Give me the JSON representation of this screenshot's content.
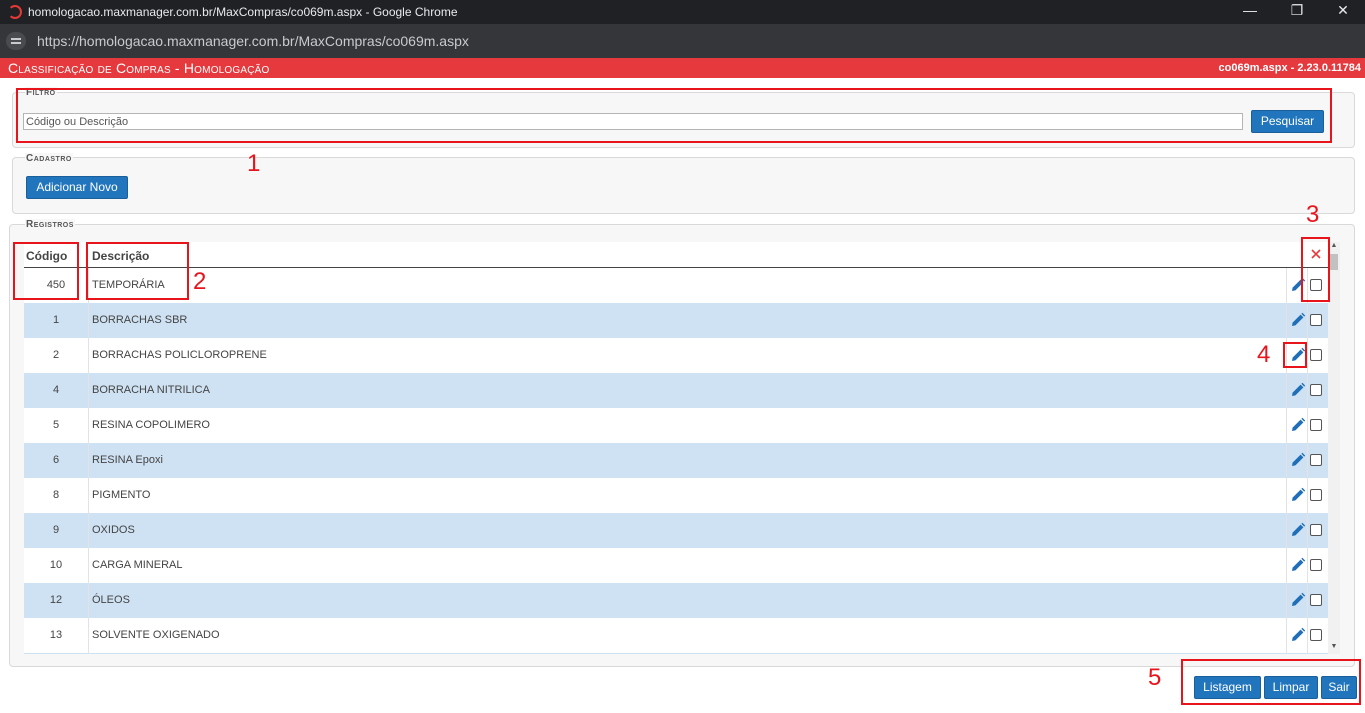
{
  "browser": {
    "window_title": "homologacao.maxmanager.com.br/MaxCompras/co069m.aspx - Google Chrome",
    "url": "https://homologacao.maxmanager.com.br/MaxCompras/co069m.aspx",
    "controls": {
      "minimize": "—",
      "restore": "❐",
      "close": "✕"
    }
  },
  "header": {
    "title": "Classificação de Compras  - Homologação",
    "version": "co069m.aspx - 2.23.0.11784",
    "color": "#e5393d"
  },
  "filtro": {
    "legend": "Filtro",
    "search_placeholder": "Código ou Descrição",
    "search_value": "",
    "search_button": "Pesquisar"
  },
  "cadastro": {
    "legend": "Cadastro",
    "add_button": "Adicionar Novo"
  },
  "registros": {
    "legend": "Registros",
    "columns": {
      "code": "Código",
      "description": "Descrição",
      "delete_icon": "close-icon"
    },
    "rows": [
      {
        "code": "450",
        "description": "TEMPORÁRIA"
      },
      {
        "code": "1",
        "description": "BORRACHAS SBR"
      },
      {
        "code": "2",
        "description": "BORRACHAS POLICLOROPRENE"
      },
      {
        "code": "4",
        "description": "BORRACHA NITRILICA"
      },
      {
        "code": "5",
        "description": "RESINA COPOLIMERO"
      },
      {
        "code": "6",
        "description": "RESINA Epoxi"
      },
      {
        "code": "8",
        "description": "PIGMENTO"
      },
      {
        "code": "9",
        "description": "OXIDOS"
      },
      {
        "code": "10",
        "description": "CARGA MINERAL"
      },
      {
        "code": "12",
        "description": "ÓLEOS"
      },
      {
        "code": "13",
        "description": "SOLVENTE OXIGENADO"
      }
    ]
  },
  "footer": {
    "listagem": "Listagem",
    "limpar": "Limpar",
    "sair": "Sair"
  },
  "annotations": [
    "1",
    "2",
    "3",
    "4",
    "5"
  ],
  "colors": {
    "accent": "#2175bc",
    "alt_row": "#cfe2f3",
    "annotation": "#e8141b"
  }
}
